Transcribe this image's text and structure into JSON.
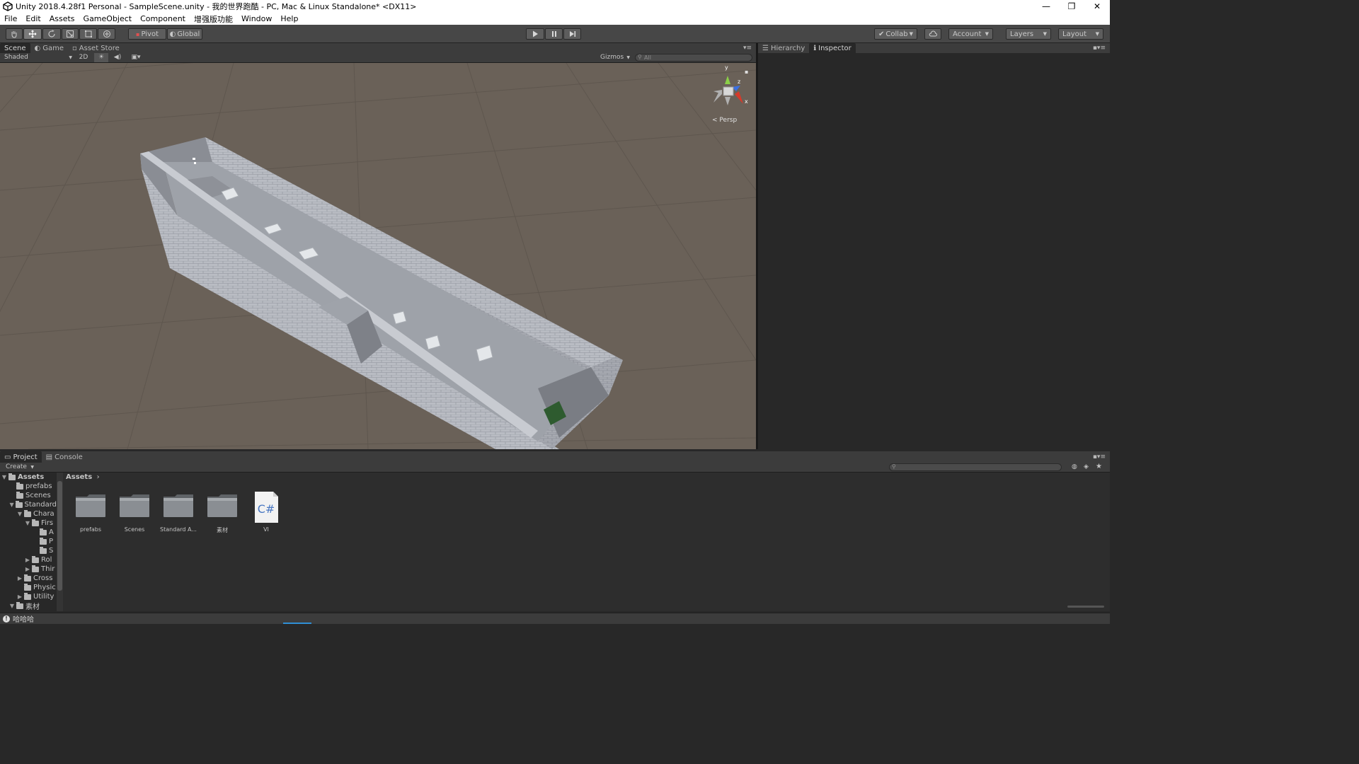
{
  "window": {
    "title": "Unity 2018.4.28f1 Personal - SampleScene.unity - 我的世界跑酷 - PC, Mac & Linux Standalone* <DX11>",
    "minimize": "—",
    "restore": "❐",
    "close": "✕"
  },
  "menu": [
    "File",
    "Edit",
    "Assets",
    "GameObject",
    "Component",
    "增强版功能",
    "Window",
    "Help"
  ],
  "toolbar": {
    "pivot": "Pivot",
    "global": "Global",
    "collab": "Collab",
    "account": "Account",
    "layers": "Layers",
    "layout": "Layout"
  },
  "scene_tabs": [
    "Scene",
    "Game",
    "Asset Store"
  ],
  "scene_bar": {
    "shading": "Shaded",
    "mode2d": "2D",
    "gizmos": "Gizmos",
    "search_placeholder": "All"
  },
  "gizmo": {
    "persp_label": "Persp",
    "axis_y": "y",
    "axis_z": "z",
    "axis_x": "x"
  },
  "right_tabs": [
    "Hierarchy",
    "Inspector"
  ],
  "bottom_tabs": [
    "Project",
    "Console"
  ],
  "project": {
    "create": "Create",
    "breadcrumb": "Assets",
    "tree": [
      {
        "label": "Assets",
        "depth": 0,
        "fold": "▼",
        "selected": true
      },
      {
        "label": "prefabs",
        "depth": 1,
        "fold": ""
      },
      {
        "label": "Scenes",
        "depth": 1,
        "fold": ""
      },
      {
        "label": "Standard",
        "depth": 1,
        "fold": "▼"
      },
      {
        "label": "Chara",
        "depth": 2,
        "fold": "▼"
      },
      {
        "label": "Firs",
        "depth": 3,
        "fold": "▼"
      },
      {
        "label": "A",
        "depth": 4,
        "fold": ""
      },
      {
        "label": "P",
        "depth": 4,
        "fold": ""
      },
      {
        "label": "S",
        "depth": 4,
        "fold": ""
      },
      {
        "label": "Rol",
        "depth": 3,
        "fold": "▶"
      },
      {
        "label": "Thir",
        "depth": 3,
        "fold": "▶"
      },
      {
        "label": "Cross",
        "depth": 2,
        "fold": "▶"
      },
      {
        "label": "Physic",
        "depth": 2,
        "fold": ""
      },
      {
        "label": "Utility",
        "depth": 2,
        "fold": "▶"
      },
      {
        "label": "素材",
        "depth": 1,
        "fold": "▼"
      }
    ],
    "assets": [
      {
        "name": "prefabs",
        "type": "folder"
      },
      {
        "name": "Scenes",
        "type": "folder"
      },
      {
        "name": "Standard A...",
        "type": "folder"
      },
      {
        "name": "素材",
        "type": "folder"
      },
      {
        "name": "VI",
        "type": "script",
        "glyph": "C#"
      }
    ]
  },
  "status": {
    "message": "哈哈哈"
  },
  "colors": {
    "scene_ground": "#6a6158",
    "panel_bg": "#282828",
    "accent_blue": "#2f8fd6"
  }
}
